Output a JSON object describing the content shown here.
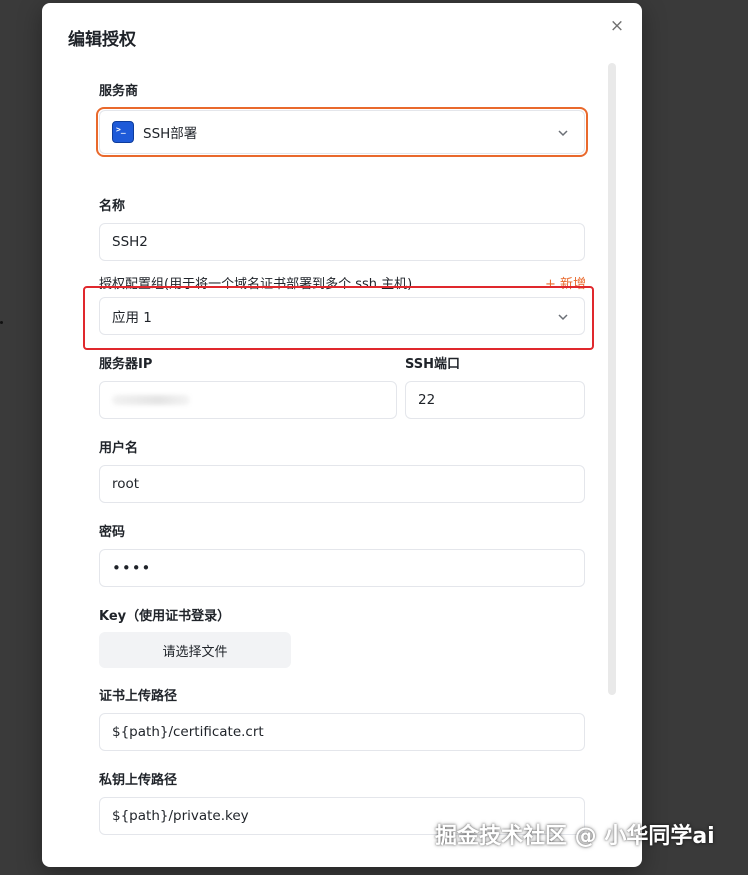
{
  "dialog": {
    "title": "编辑授权",
    "close_glyph": "×"
  },
  "provider": {
    "label": "服务商",
    "value": "SSH部署",
    "icon": "terminal-icon",
    "icon_glyph": ">_"
  },
  "name": {
    "label": "名称",
    "value": "SSH2"
  },
  "group": {
    "label": "授权配置组(用于将一个域名证书部署到多个 ssh 主机)",
    "add_label": "+ 新增",
    "value": "应用 1"
  },
  "server_ip": {
    "label": "服务器IP",
    "value": ""
  },
  "ssh_port": {
    "label": "SSH端口",
    "value": "22"
  },
  "username": {
    "label": "用户名",
    "value": "root"
  },
  "password": {
    "label": "密码",
    "value": "••••"
  },
  "key": {
    "label": "Key（使用证书登录）",
    "button_label": "请选择文件"
  },
  "cert_path": {
    "label": "证书上传路径",
    "value": "${path}/certificate.crt"
  },
  "key_path": {
    "label": "私钥上传路径",
    "value": "${path}/private.key"
  },
  "watermark": "掘金技术社区 @ 小华同学ai",
  "colors": {
    "accent_orange": "#e9692c",
    "highlight_red": "#e0282d",
    "icon_blue": "#1e5ad8",
    "backdrop": "#3a3a3a"
  }
}
